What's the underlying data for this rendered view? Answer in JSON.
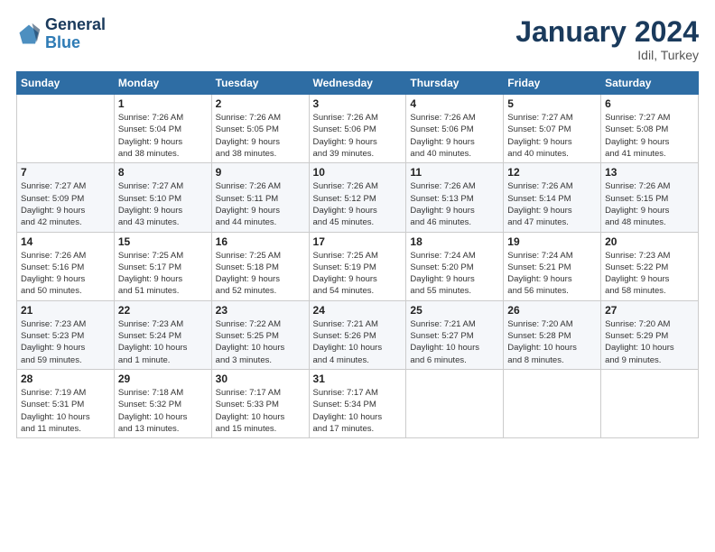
{
  "logo": {
    "line1": "General",
    "line2": "Blue"
  },
  "header": {
    "month": "January 2024",
    "location": "Idil, Turkey"
  },
  "weekdays": [
    "Sunday",
    "Monday",
    "Tuesday",
    "Wednesday",
    "Thursday",
    "Friday",
    "Saturday"
  ],
  "weeks": [
    [
      {
        "day": "",
        "info": ""
      },
      {
        "day": "1",
        "info": "Sunrise: 7:26 AM\nSunset: 5:04 PM\nDaylight: 9 hours\nand 38 minutes."
      },
      {
        "day": "2",
        "info": "Sunrise: 7:26 AM\nSunset: 5:05 PM\nDaylight: 9 hours\nand 38 minutes."
      },
      {
        "day": "3",
        "info": "Sunrise: 7:26 AM\nSunset: 5:06 PM\nDaylight: 9 hours\nand 39 minutes."
      },
      {
        "day": "4",
        "info": "Sunrise: 7:26 AM\nSunset: 5:06 PM\nDaylight: 9 hours\nand 40 minutes."
      },
      {
        "day": "5",
        "info": "Sunrise: 7:27 AM\nSunset: 5:07 PM\nDaylight: 9 hours\nand 40 minutes."
      },
      {
        "day": "6",
        "info": "Sunrise: 7:27 AM\nSunset: 5:08 PM\nDaylight: 9 hours\nand 41 minutes."
      }
    ],
    [
      {
        "day": "7",
        "info": "Sunrise: 7:27 AM\nSunset: 5:09 PM\nDaylight: 9 hours\nand 42 minutes."
      },
      {
        "day": "8",
        "info": "Sunrise: 7:27 AM\nSunset: 5:10 PM\nDaylight: 9 hours\nand 43 minutes."
      },
      {
        "day": "9",
        "info": "Sunrise: 7:26 AM\nSunset: 5:11 PM\nDaylight: 9 hours\nand 44 minutes."
      },
      {
        "day": "10",
        "info": "Sunrise: 7:26 AM\nSunset: 5:12 PM\nDaylight: 9 hours\nand 45 minutes."
      },
      {
        "day": "11",
        "info": "Sunrise: 7:26 AM\nSunset: 5:13 PM\nDaylight: 9 hours\nand 46 minutes."
      },
      {
        "day": "12",
        "info": "Sunrise: 7:26 AM\nSunset: 5:14 PM\nDaylight: 9 hours\nand 47 minutes."
      },
      {
        "day": "13",
        "info": "Sunrise: 7:26 AM\nSunset: 5:15 PM\nDaylight: 9 hours\nand 48 minutes."
      }
    ],
    [
      {
        "day": "14",
        "info": "Sunrise: 7:26 AM\nSunset: 5:16 PM\nDaylight: 9 hours\nand 50 minutes."
      },
      {
        "day": "15",
        "info": "Sunrise: 7:25 AM\nSunset: 5:17 PM\nDaylight: 9 hours\nand 51 minutes."
      },
      {
        "day": "16",
        "info": "Sunrise: 7:25 AM\nSunset: 5:18 PM\nDaylight: 9 hours\nand 52 minutes."
      },
      {
        "day": "17",
        "info": "Sunrise: 7:25 AM\nSunset: 5:19 PM\nDaylight: 9 hours\nand 54 minutes."
      },
      {
        "day": "18",
        "info": "Sunrise: 7:24 AM\nSunset: 5:20 PM\nDaylight: 9 hours\nand 55 minutes."
      },
      {
        "day": "19",
        "info": "Sunrise: 7:24 AM\nSunset: 5:21 PM\nDaylight: 9 hours\nand 56 minutes."
      },
      {
        "day": "20",
        "info": "Sunrise: 7:23 AM\nSunset: 5:22 PM\nDaylight: 9 hours\nand 58 minutes."
      }
    ],
    [
      {
        "day": "21",
        "info": "Sunrise: 7:23 AM\nSunset: 5:23 PM\nDaylight: 9 hours\nand 59 minutes."
      },
      {
        "day": "22",
        "info": "Sunrise: 7:23 AM\nSunset: 5:24 PM\nDaylight: 10 hours\nand 1 minute."
      },
      {
        "day": "23",
        "info": "Sunrise: 7:22 AM\nSunset: 5:25 PM\nDaylight: 10 hours\nand 3 minutes."
      },
      {
        "day": "24",
        "info": "Sunrise: 7:21 AM\nSunset: 5:26 PM\nDaylight: 10 hours\nand 4 minutes."
      },
      {
        "day": "25",
        "info": "Sunrise: 7:21 AM\nSunset: 5:27 PM\nDaylight: 10 hours\nand 6 minutes."
      },
      {
        "day": "26",
        "info": "Sunrise: 7:20 AM\nSunset: 5:28 PM\nDaylight: 10 hours\nand 8 minutes."
      },
      {
        "day": "27",
        "info": "Sunrise: 7:20 AM\nSunset: 5:29 PM\nDaylight: 10 hours\nand 9 minutes."
      }
    ],
    [
      {
        "day": "28",
        "info": "Sunrise: 7:19 AM\nSunset: 5:31 PM\nDaylight: 10 hours\nand 11 minutes."
      },
      {
        "day": "29",
        "info": "Sunrise: 7:18 AM\nSunset: 5:32 PM\nDaylight: 10 hours\nand 13 minutes."
      },
      {
        "day": "30",
        "info": "Sunrise: 7:17 AM\nSunset: 5:33 PM\nDaylight: 10 hours\nand 15 minutes."
      },
      {
        "day": "31",
        "info": "Sunrise: 7:17 AM\nSunset: 5:34 PM\nDaylight: 10 hours\nand 17 minutes."
      },
      {
        "day": "",
        "info": ""
      },
      {
        "day": "",
        "info": ""
      },
      {
        "day": "",
        "info": ""
      }
    ]
  ]
}
